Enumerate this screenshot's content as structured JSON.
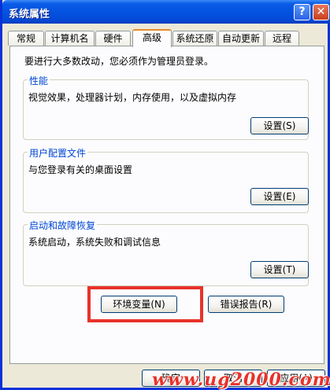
{
  "window": {
    "title": "系统属性",
    "help_glyph": "?",
    "close_glyph": "✕"
  },
  "tabs": [
    {
      "label": "常规"
    },
    {
      "label": "计算机名"
    },
    {
      "label": "硬件"
    },
    {
      "label": "高级",
      "active": true
    },
    {
      "label": "系统还原"
    },
    {
      "label": "自动更新"
    },
    {
      "label": "远程"
    }
  ],
  "intro": "要进行大多数改动，您必须作为管理员登录。",
  "performance": {
    "label": "性能",
    "desc": "视觉效果，处理器计划，内存使用，以及虚拟内存",
    "button": "设置(S)"
  },
  "user_profiles": {
    "label": "用户配置文件",
    "desc": "与您登录有关的桌面设置",
    "button": "设置(E)"
  },
  "startup_recovery": {
    "label": "启动和故障恢复",
    "desc": "系统启动，系统失败和调试信息",
    "button": "设置(T)"
  },
  "env_button": "环境变量(N)",
  "error_report_button": "错误报告(R)",
  "ok_button": "确定",
  "cancel_button": "取消",
  "apply_button": "应用(A)",
  "watermark": "www.ug2000.com",
  "colors": {
    "accent": "#e68b2c",
    "highlight": "#e8322a",
    "group_label": "#0046d5"
  }
}
